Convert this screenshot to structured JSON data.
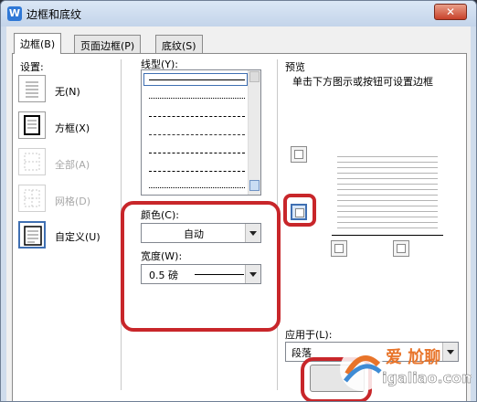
{
  "window": {
    "title": "边框和底纹",
    "app_icon": "W"
  },
  "tabs": [
    {
      "label": "边框(B)"
    },
    {
      "label": "页面边框(P)"
    },
    {
      "label": "底纹(S)"
    }
  ],
  "setting": {
    "label": "设置:",
    "presets": [
      {
        "label": "无(N)",
        "enabled": true
      },
      {
        "label": "方框(X)",
        "enabled": true
      },
      {
        "label": "全部(A)",
        "enabled": false
      },
      {
        "label": "网格(D)",
        "enabled": false
      },
      {
        "label": "自定义(U)",
        "enabled": true,
        "selected": true
      }
    ]
  },
  "line_style": {
    "label": "线型(Y):"
  },
  "color": {
    "label": "颜色(C):",
    "value": "自动"
  },
  "width": {
    "label": "宽度(W):",
    "value": "0.5  磅"
  },
  "preview": {
    "label": "预览",
    "hint": "单击下方图示或按钮可设置边框"
  },
  "apply_to": {
    "label": "应用于(L):",
    "value": "段落"
  },
  "watermark": {
    "text": "igaliao.com",
    "brand": "爱 尬聊"
  },
  "colors": {
    "highlight": "#c8262a",
    "selection": "#3f6fb2"
  }
}
